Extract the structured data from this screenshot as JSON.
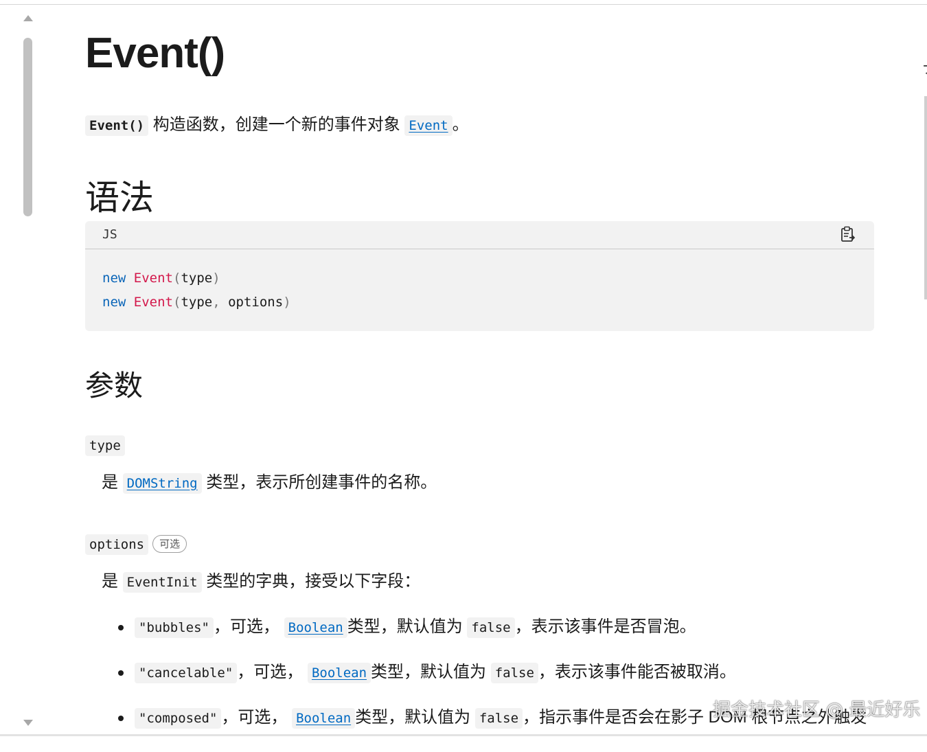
{
  "page": {
    "title": "Event()",
    "intro": {
      "code": "Event()",
      "text": "构造函数，创建一个新的事件对象",
      "link": "Event",
      "end": "。"
    }
  },
  "syntax": {
    "heading": "语法",
    "lang": "JS",
    "copy_icon": "clipboard-copy-icon",
    "lines": [
      {
        "kw": "new",
        "fn": "Event",
        "open": "(",
        "args": "type",
        "close": ")"
      },
      {
        "kw": "new",
        "fn": "Event",
        "open": "(",
        "args": "type",
        "comma": ",",
        "args2": "options",
        "close": ")"
      }
    ]
  },
  "params": {
    "heading": "参数",
    "type": {
      "name": "type",
      "desc_prefix": "是",
      "desc_link": "DOMString",
      "desc_suffix": "类型，表示所创建事件的名称。"
    },
    "options": {
      "name": "options",
      "badge": "可选",
      "desc_prefix": "是",
      "desc_code": "EventInit",
      "desc_suffix": "类型的字典，接受以下字段："
    },
    "fields": [
      {
        "key": "\"bubbles\"",
        "sep": "，可选，",
        "type_link": "Boolean",
        "mid": "类型，默认值为",
        "default": "false",
        "tail": "，表示该事件是否冒泡。"
      },
      {
        "key": "\"cancelable\"",
        "sep": "，可选，",
        "type_link": "Boolean",
        "mid": "类型，默认值为",
        "default": "false",
        "tail": "，表示该事件能否被取消。"
      },
      {
        "key": "\"composed\"",
        "sep": "，可选，",
        "type_link": "Boolean",
        "mid": "类型，默认值为",
        "default": "false",
        "tail": "，指示事件是否会在影子 DOM 根节点之外触发"
      }
    ]
  },
  "watermark": "掘金技术社区 @ 最近好乐",
  "right_edge_glyph": "ナ"
}
